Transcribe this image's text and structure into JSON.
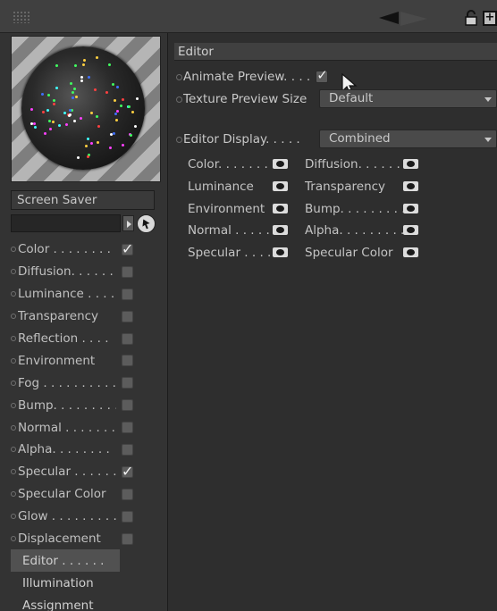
{
  "material": {
    "name": "Screen Saver"
  },
  "channels": [
    {
      "label": "Color . . . . . . . .",
      "checked": true
    },
    {
      "label": "Diffusion. . . . . .",
      "checked": false
    },
    {
      "label": "Luminance . . . .",
      "checked": false
    },
    {
      "label": "Transparency",
      "checked": false
    },
    {
      "label": "Reflection . . . .",
      "checked": false
    },
    {
      "label": "Environment",
      "checked": false
    },
    {
      "label": "Fog . . . . . . . . . .",
      "checked": false
    },
    {
      "label": "Bump. . . . . . . . .",
      "checked": false
    },
    {
      "label": "Normal . . . . . . .",
      "checked": false
    },
    {
      "label": "Alpha. . . . . . . .",
      "checked": false
    },
    {
      "label": "Specular . . . . . .",
      "checked": true
    },
    {
      "label": "Specular Color",
      "checked": false
    },
    {
      "label": "Glow . . . . . . . . .",
      "checked": false
    },
    {
      "label": "Displacement",
      "checked": false
    }
  ],
  "pages": [
    {
      "label": "Editor . . . . . . . ."
    },
    {
      "label": "Illumination"
    },
    {
      "label": "Assignment"
    }
  ],
  "editor": {
    "section_title": "Editor",
    "animate_preview_label": "Animate Preview. . . .",
    "animate_preview_checked": true,
    "texture_preview_size_label": "Texture Preview Size",
    "texture_preview_size_value": "Default",
    "editor_display_label": "Editor Display. . . . .",
    "editor_display_value": "Combined",
    "visibility": [
      {
        "left": "Color. . . . . . .",
        "right": "Diffusion. . . . . ."
      },
      {
        "left": "Luminance",
        "right": "Transparency"
      },
      {
        "left": "Environment",
        "right": "Bump. . . . . . . . ."
      },
      {
        "left": "Normal . . . . .",
        "right": "Alpha. . . . . . . . ."
      },
      {
        "left": "Specular . . . .",
        "right": "Specular Color"
      }
    ]
  },
  "icons": {
    "grip": "grip-icon",
    "back": "back-arrow-icon",
    "forward": "forward-arrow-icon",
    "lock": "lock-icon",
    "new_window": "new-window-icon",
    "picker": "pick-icon",
    "eye": "eye-icon"
  }
}
